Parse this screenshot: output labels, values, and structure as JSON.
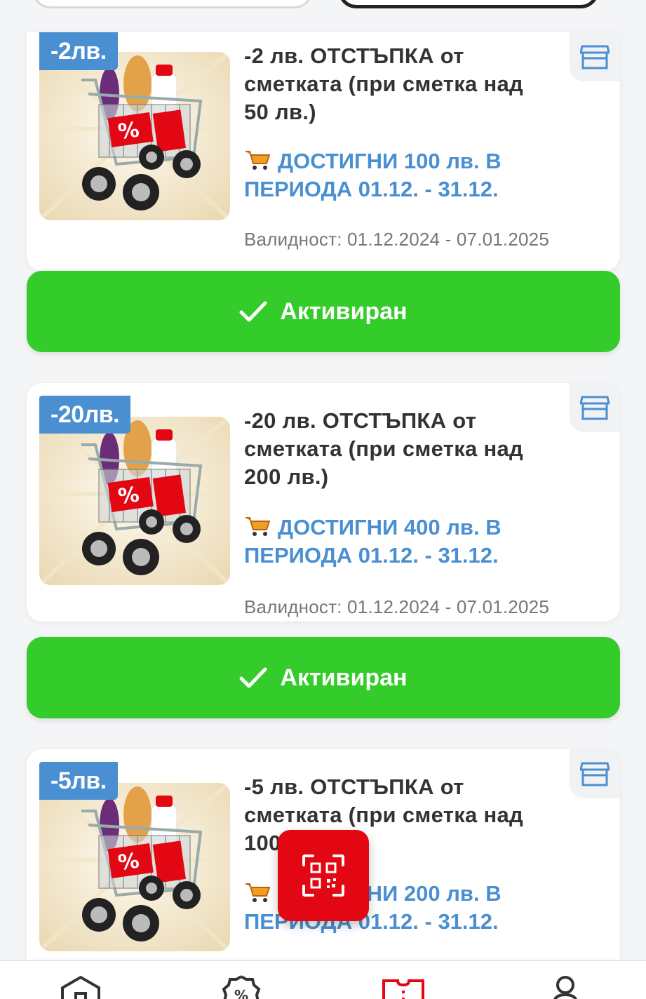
{
  "coupons": [
    {
      "badge": "-2лв.",
      "title": "-2 лв. ОТСТЪПКА от сметката (при сметка над 50 лв.)",
      "goal": "ДОСТИГНИ 100 лв. В ПЕРИОДА 01.12. - 31.12.",
      "validity": "Валидност: 01.12.2024 - 07.01.2025",
      "button_label": "Активиран"
    },
    {
      "badge": "-20лв.",
      "title": "-20 лв. ОТСТЪПКА от сметката (при сметка над 200 лв.)",
      "goal": "ДОСТИГНИ 400 лв. В ПЕРИОДА 01.12. - 31.12.",
      "validity": "Валидност: 01.12.2024 - 07.01.2025",
      "button_label": "Активиран"
    },
    {
      "badge": "-5лв.",
      "title": "-5 лв. ОТСТЪПКА от сметката (при сметка над 100 лв.)",
      "goal": "ДОСТИГНИ 200 лв. В ПЕРИОДА 01.12. - 31.12."
    }
  ],
  "colors": {
    "accent_blue": "#4a8fd1",
    "activate_green": "#33cc2a",
    "brand_red": "#e30613"
  },
  "icons": {
    "store": "store-icon",
    "qr": "qr-scan-icon",
    "check": "check-icon",
    "cart": "shopping-cart-emoji"
  },
  "bottom_nav": [
    {
      "icon": "home-icon"
    },
    {
      "icon": "discount-badge-icon"
    },
    {
      "icon": "coupon-ticket-icon",
      "active": true
    },
    {
      "icon": "profile-icon"
    }
  ]
}
